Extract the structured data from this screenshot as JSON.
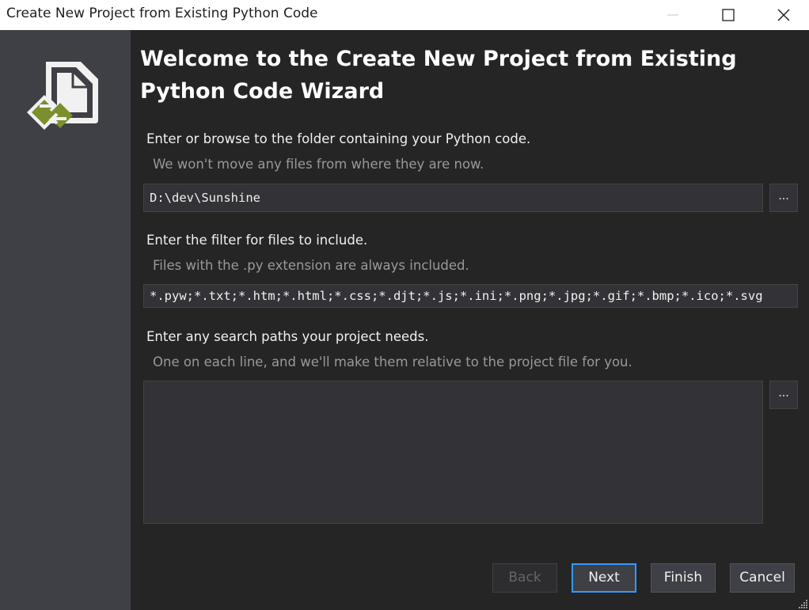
{
  "window": {
    "title": "Create New Project from Existing Python Code",
    "minimize_icon": "minimize-icon",
    "maximize_icon": "maximize-icon",
    "close_icon": "close-icon"
  },
  "sidebar": {
    "logo_icon": "python-project-import-icon",
    "colors": {
      "accent_green": "#7a8f2e",
      "logo_white": "#f1f1f1"
    }
  },
  "wizard": {
    "heading": "Welcome to the Create New Project from Existing Python Code Wizard",
    "folder": {
      "label": "Enter or browse to the folder containing your Python code.",
      "hint": "We won't move any files from where they are now.",
      "value": "D:\\dev\\Sunshine",
      "browse_label": "..."
    },
    "filter": {
      "label": "Enter the filter for files to include.",
      "hint": "Files with the .py extension are always included.",
      "value": "*.pyw;*.txt;*.htm;*.html;*.css;*.djt;*.js;*.ini;*.png;*.jpg;*.gif;*.bmp;*.ico;*.svg"
    },
    "search_paths": {
      "label": "Enter any search paths your project needs.",
      "hint": "One on each line, and we'll make them relative to the project file for you.",
      "value": "",
      "browse_label": "..."
    }
  },
  "buttons": {
    "back": "Back",
    "next": "Next",
    "finish": "Finish",
    "cancel": "Cancel"
  },
  "colors": {
    "background": "#252526",
    "sidebar": "#3f3f46",
    "focus_border": "#3399ff"
  }
}
